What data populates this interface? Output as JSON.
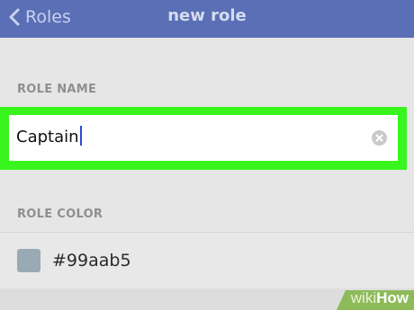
{
  "header": {
    "back_label": "Roles",
    "title": "new role"
  },
  "role_name": {
    "section_label": "ROLE NAME",
    "value": "Captain"
  },
  "role_color": {
    "section_label": "ROLE COLOR",
    "value": "#99aab5",
    "swatch_color": "#99aab5"
  },
  "watermark": {
    "prefix": "wiki",
    "suffix": "How"
  },
  "colors": {
    "topbar": "#5a6fb6",
    "highlight": "#39f51e",
    "background": "#e6e6e6"
  }
}
